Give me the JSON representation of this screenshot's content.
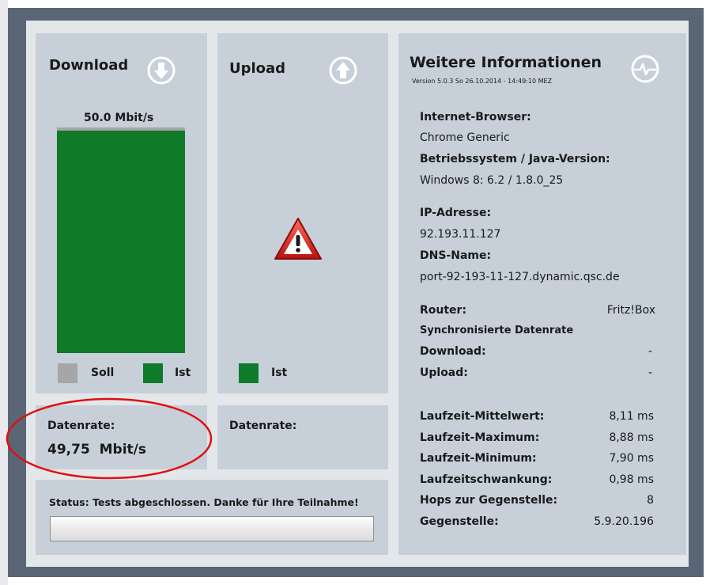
{
  "download": {
    "title": "Download",
    "max_label": "50.0 Mbit/s",
    "bar_fraction": 1.0,
    "legend_soll": "Soll",
    "legend_ist": "Ist",
    "rate_label": "Datenrate:",
    "rate_value": "49,75  Mbit/s"
  },
  "upload": {
    "title": "Upload",
    "legend_ist": "Ist",
    "rate_label": "Datenrate:"
  },
  "info": {
    "title": "Weitere Informationen",
    "version": "Version 5.0.3   So 26.10.2014 - 14:49:10 MEZ",
    "browser_label": "Internet-Browser:",
    "browser_value": "Chrome Generic",
    "os_label": "Betriebssystem / Java-Version:",
    "os_value": "Windows 8: 6.2 / 1.8.0_25",
    "ip_label": "IP-Adresse:",
    "ip_value": "92.193.11.127",
    "dns_label": "DNS-Name:",
    "dns_value": "port-92-193-11-127.dynamic.qsc.de",
    "router_label": "Router:",
    "router_value": "Fritz!Box",
    "sync_label": "Synchronisierte Datenrate",
    "sync_down_label": "Download:",
    "sync_down_value": "-",
    "sync_up_label": "Upload:",
    "sync_up_value": "-",
    "stats": [
      {
        "label": "Laufzeit-Mittelwert:",
        "value": "8,11 ms"
      },
      {
        "label": "Laufzeit-Maximum:",
        "value": "8,88 ms"
      },
      {
        "label": "Laufzeit-Minimum:",
        "value": "7,90 ms"
      },
      {
        "label": "Laufzeitschwankung:",
        "value": "0,98 ms"
      },
      {
        "label": "Hops zur Gegenstelle:",
        "value": "8"
      },
      {
        "label": "Gegenstelle:",
        "value": "5.9.20.196"
      }
    ]
  },
  "status": {
    "label": "Status:",
    "text": "Tests abgeschlossen. Danke für Ihre Teilnahme!",
    "progress_fraction": 0
  },
  "colors": {
    "ist_green": "#0f7a2a",
    "soll_gray": "#a6a6a6",
    "panel": "#c7d0d9",
    "annotation_red": "#e01010"
  }
}
